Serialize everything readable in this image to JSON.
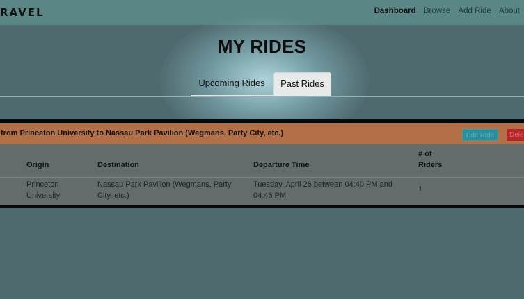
{
  "nav": {
    "brand": "RAVEL",
    "links": [
      "Dashboard",
      "Browse",
      "Add Ride",
      "About"
    ],
    "active": "Dashboard"
  },
  "page": {
    "title": "MY RIDES",
    "tabs": [
      {
        "label": "Upcoming Rides",
        "selected": false
      },
      {
        "label": "Past Rides",
        "selected": true
      }
    ]
  },
  "ride": {
    "header": "from Princeton University to Nassau Park Pavilion (Wegmans, Party City, etc.)",
    "edit_label": "Edit Ride",
    "delete_label": "Dele",
    "columns": [
      "Origin",
      "Destination",
      "Departure Time",
      "# of Riders"
    ],
    "row": {
      "origin": "Princeton University",
      "destination": "Nassau Park Pavilion (Wegmans, Party City, etc.)",
      "departure": "Tuesday, April 26 between 04:40 PM and 04:45 PM",
      "riders": "1"
    }
  },
  "colors": {
    "background": "#4f6a6f",
    "navbar": "#5a8685",
    "card_header": "#b36f45",
    "edit_button": "#2b8e9a",
    "delete_button": "#b2272a"
  }
}
